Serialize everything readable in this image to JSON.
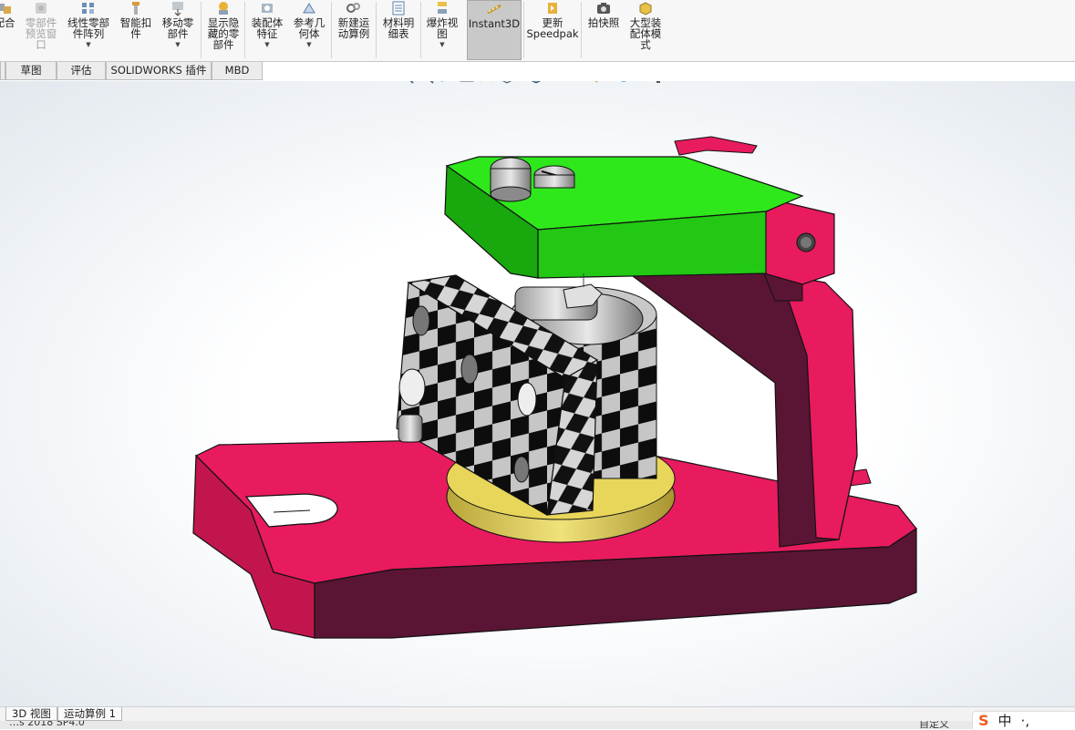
{
  "ribbon": {
    "buttons": [
      {
        "label": "配合",
        "disabled": false,
        "dropdown": false
      },
      {
        "label": "零部件\n预览窗\n口",
        "disabled": true,
        "dropdown": false
      },
      {
        "label": "线性零部\n件阵列",
        "disabled": false,
        "dropdown": true
      },
      {
        "label": "智能扣\n件",
        "disabled": false,
        "dropdown": false
      },
      {
        "label": "移动零\n部件",
        "disabled": false,
        "dropdown": true
      },
      {
        "label": "显示隐\n藏的零\n部件",
        "disabled": false,
        "dropdown": false
      },
      {
        "label": "装配体\n特征",
        "disabled": false,
        "dropdown": true
      },
      {
        "label": "参考几\n何体",
        "disabled": false,
        "dropdown": true
      },
      {
        "label": "新建运\n动算例",
        "disabled": false,
        "dropdown": false
      },
      {
        "label": "材料明\n细表",
        "disabled": false,
        "dropdown": false
      },
      {
        "label": "爆炸视\n图",
        "disabled": false,
        "dropdown": true
      },
      {
        "label": "Instant3D",
        "disabled": false,
        "dropdown": false,
        "active": true
      },
      {
        "label": "更新\nSpeedpak",
        "disabled": false,
        "dropdown": false
      },
      {
        "label": "拍快照",
        "disabled": false,
        "dropdown": false
      },
      {
        "label": "大型装\n配体模\n式",
        "disabled": false,
        "dropdown": false
      }
    ]
  },
  "command_tabs": [
    "草图",
    "评估",
    "SOLIDWORKS 插件",
    "MBD"
  ],
  "headsup_icons": [
    "zoom-to-fit-icon",
    "zoom-to-area-icon",
    "previous-view-icon",
    "section-view-icon",
    "dynamic-annotation-icon",
    "view-orientation-icon",
    "display-style-icon",
    "hide-show-items-icon",
    "edit-appearance-icon",
    "apply-scene-icon",
    "view-settings-icon"
  ],
  "bottom_tabs": [
    "3D 视图",
    "运动算例 1"
  ],
  "status": {
    "left_text": "…s 2018 SP4.0",
    "right_text": "自定义"
  },
  "ime": {
    "logo": "S",
    "lang": "中",
    "extra": "·,"
  },
  "colors": {
    "base_plate": "#e81b5e",
    "base_plate_dark": "#5a1535",
    "top_clamp": "#2ee81c",
    "checker_dark": "#111111",
    "checker_light": "#d6d6d6",
    "brass_ring": "#e8d65a",
    "background": "#ffffff"
  }
}
